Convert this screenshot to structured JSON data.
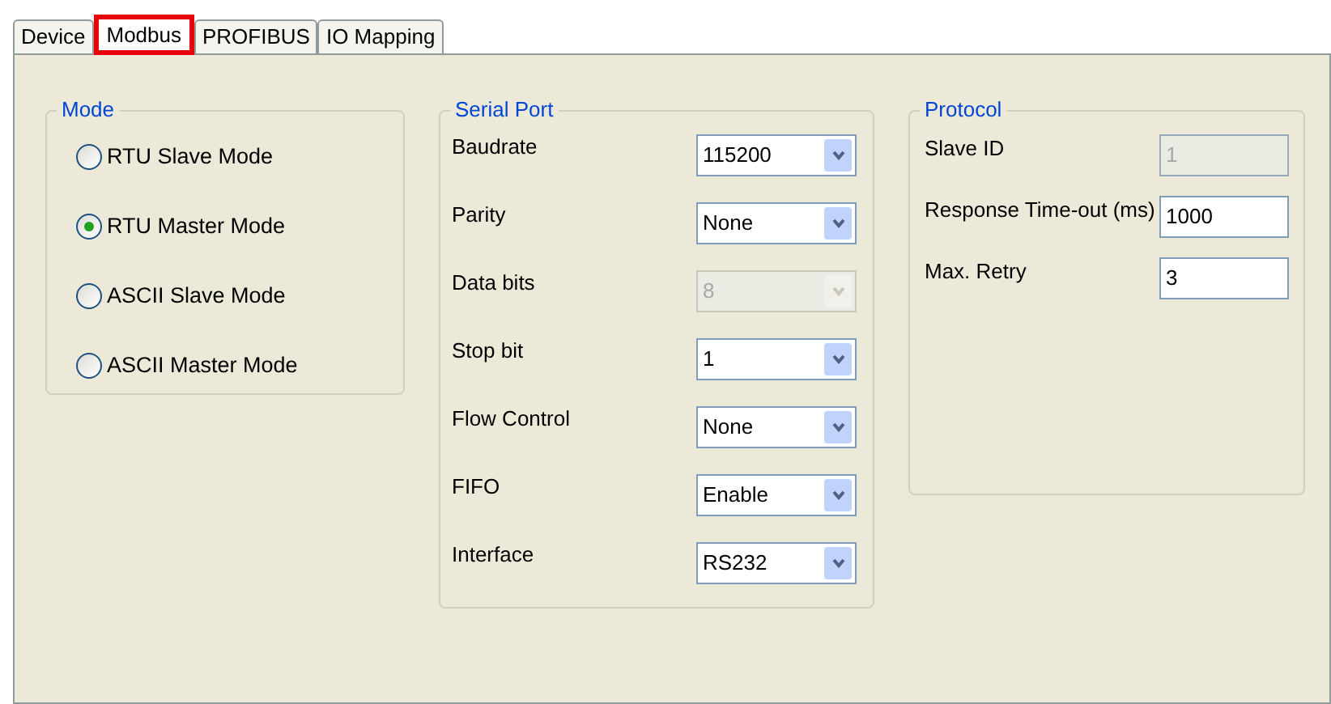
{
  "tabs": [
    {
      "label": "Device",
      "selected": false
    },
    {
      "label": "Modbus",
      "selected": true
    },
    {
      "label": "PROFIBUS",
      "selected": false
    },
    {
      "label": "IO Mapping",
      "selected": false
    }
  ],
  "mode": {
    "title": "Mode",
    "options": [
      {
        "label": "RTU Slave Mode",
        "selected": false
      },
      {
        "label": "RTU Master Mode",
        "selected": true
      },
      {
        "label": "ASCII Slave Mode",
        "selected": false
      },
      {
        "label": "ASCII Master Mode",
        "selected": false
      }
    ]
  },
  "serial_port": {
    "title": "Serial Port",
    "fields": [
      {
        "label": "Baudrate",
        "value": "115200",
        "disabled": false
      },
      {
        "label": "Parity",
        "value": "None",
        "disabled": false
      },
      {
        "label": "Data bits",
        "value": "8",
        "disabled": true
      },
      {
        "label": "Stop bit",
        "value": "1",
        "disabled": false
      },
      {
        "label": "Flow Control",
        "value": "None",
        "disabled": false
      },
      {
        "label": "FIFO",
        "value": "Enable",
        "disabled": false
      },
      {
        "label": "Interface",
        "value": "RS232",
        "disabled": false
      }
    ]
  },
  "protocol": {
    "title": "Protocol",
    "fields": [
      {
        "label": "Slave ID",
        "value": "1",
        "disabled": true
      },
      {
        "label": "Response Time-out (ms)",
        "value": "1000",
        "disabled": false
      },
      {
        "label": "Max. Retry",
        "value": "3",
        "disabled": false
      }
    ]
  }
}
